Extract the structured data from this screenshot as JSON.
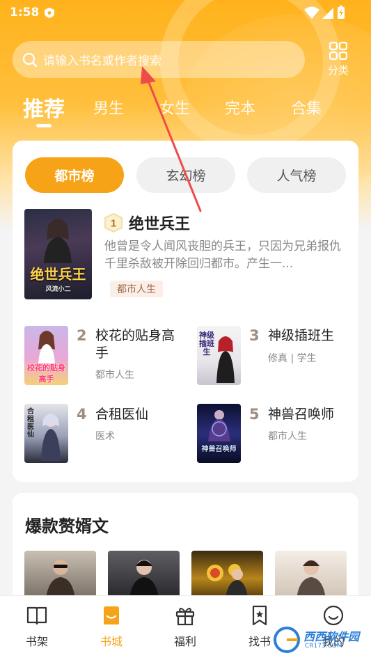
{
  "status_bar": {
    "time": "1:58"
  },
  "search": {
    "placeholder": "请输入书名或作者搜索"
  },
  "category_button": {
    "label": "分类"
  },
  "tabs": [
    {
      "label": "推荐",
      "active": true
    },
    {
      "label": "男生",
      "active": false
    },
    {
      "label": "女生",
      "active": false
    },
    {
      "label": "完本",
      "active": false
    },
    {
      "label": "合集",
      "active": false
    }
  ],
  "ranking": {
    "pills": [
      {
        "label": "都市榜",
        "active": true
      },
      {
        "label": "玄幻榜",
        "active": false
      },
      {
        "label": "人气榜",
        "active": false
      }
    ],
    "top_book": {
      "rank": "1",
      "title": "绝世兵王",
      "description": "他曾是令人闻风丧胆的兵王，只因为兄弟报仇千里杀敌被开除回归都市。产生一...",
      "tag": "都市人生",
      "cover_text": "绝世兵王",
      "cover_author": "风流小二"
    },
    "books": [
      {
        "rank": "2",
        "title": "校花的贴身高手",
        "tags": "都市人生",
        "cover_text": "校花的贴身高手"
      },
      {
        "rank": "3",
        "title": "神级插班生",
        "tags": "修真 | 学生",
        "cover_text": "神级插班生"
      },
      {
        "rank": "4",
        "title": "合租医仙",
        "tags": "医术",
        "cover_text": "合租医仙"
      },
      {
        "rank": "5",
        "title": "神兽召唤师",
        "tags": "都市人生",
        "cover_text": "神兽召唤师"
      }
    ]
  },
  "section2": {
    "heading": "爆款赘婿文"
  },
  "bottom_nav": [
    {
      "label": "书架",
      "icon": "book-open-icon",
      "active": false
    },
    {
      "label": "书城",
      "icon": "store-icon",
      "active": true
    },
    {
      "label": "福利",
      "icon": "gift-icon",
      "active": false
    },
    {
      "label": "找书",
      "icon": "bookmark-star-icon",
      "active": false
    },
    {
      "label": "我的",
      "icon": "smile-icon",
      "active": false
    }
  ],
  "watermark": {
    "brand": "西西软件园",
    "url": "CR173.COM"
  },
  "colors": {
    "accent": "#f7a318",
    "header": "#ffb21c",
    "muted": "#888888"
  }
}
